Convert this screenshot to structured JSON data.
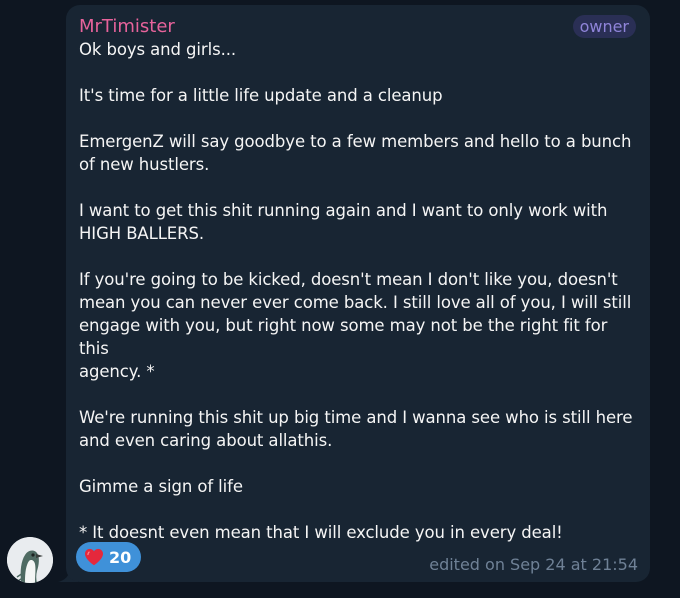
{
  "message": {
    "sender": "MrTimister",
    "role_badge": "owner",
    "text": "Ok boys and girls...\n\nIt's time for a little life update and a cleanup\n\nEmergenZ will say goodbye to a few members and hello to a bunch\nof new hustlers.\n\nI want to get this shit running again and I want to only work with\nHIGH BALLERS.\n\nIf you're going to be kicked, doesn't mean I don't like you, doesn't\nmean you can never ever come back. I still love all of you, I will still\nengage with you, but right now some may not be the right fit for this\nagency. *\n\nWe're running this shit up big time and I wanna see who is still here\nand even caring about allathis.\n\nGimme a sign of life\n\n* It doesnt even mean that I will exclude you in every deal!",
    "reaction": {
      "icon": "heart-icon",
      "count": "20"
    },
    "edited": "edited on Sep 24 at 21:54"
  },
  "avatar": {
    "icon": "bird-avatar-icon"
  },
  "colors": {
    "background": "#0e1621",
    "bubble": "#182533",
    "sender": "#e7639b",
    "badge_bg": "#2a2f55",
    "badge_text": "#8f84d9",
    "reaction_bg": "#3f91d9",
    "meta": "#6f8196"
  }
}
